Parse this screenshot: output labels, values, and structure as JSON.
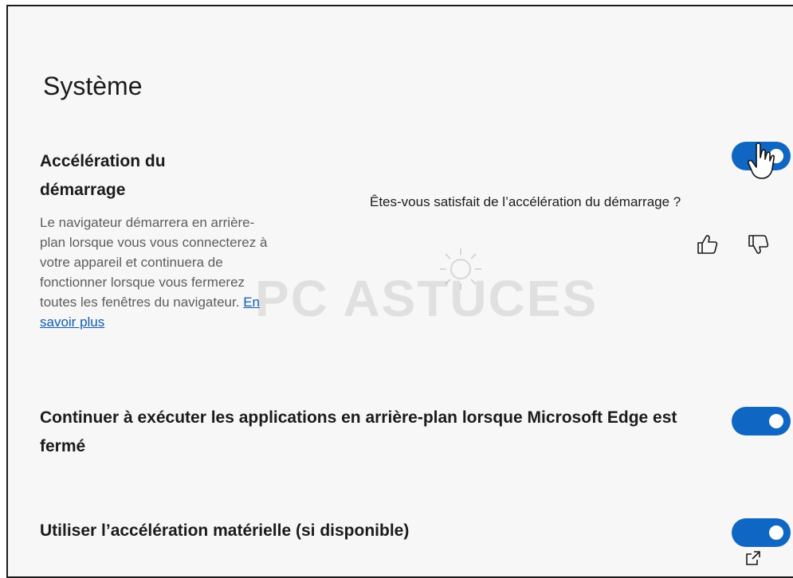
{
  "section": {
    "title": "Système"
  },
  "startup_boost": {
    "title": "Accélération du démarrage",
    "description": "Le navigateur démarrera en arrière-plan lorsque vous vous connecterez à votre appareil et continuera de fonctionner lorsque vous fermerez toutes les fenêtres du navigateur.",
    "learn_more": "En savoir plus",
    "toggle_on": true,
    "feedback_question": "Êtes-vous satisfait de l’accélération du démarrage ?",
    "thumbs_up_icon": "thumbs-up-icon",
    "thumbs_down_icon": "thumbs-down-icon"
  },
  "background_apps": {
    "label": "Continuer à exécuter les applications en arrière-plan lorsque Microsoft Edge est fermé",
    "toggle_on": true
  },
  "hardware_acceleration": {
    "label": "Utiliser l’accélération matérielle (si disponible)",
    "toggle_on": true
  },
  "watermark": {
    "text": "PC ASTUCES"
  },
  "colors": {
    "accent": "#0f67c3",
    "link": "#0f5bb0",
    "background": "#f7f7f7"
  }
}
